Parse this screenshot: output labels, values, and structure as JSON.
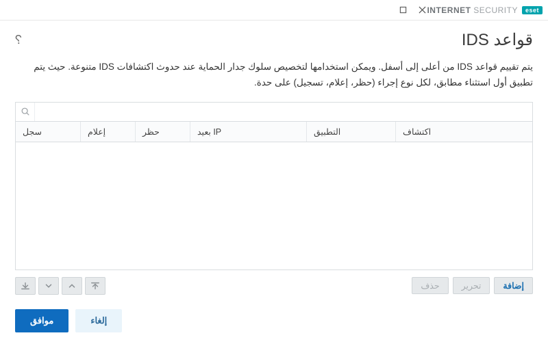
{
  "brand": {
    "logo": "eset",
    "strong": "INTERNET",
    "light": "SECURITY"
  },
  "page": {
    "title": "قواعد IDS",
    "description": "يتم تقييم قواعد IDS من أعلى إلى أسفل. ويمكن استخدامها لتخصيص سلوك جدار الحماية عند حدوث اكتشافات IDS متنوعة. حيث يتم تطبيق أول استثناء مطابق، لكل نوع إجراء (حظر، إعلام، تسجيل) على حدة."
  },
  "search": {
    "placeholder": ""
  },
  "columns": {
    "detect": "اكتشاف",
    "app": "التطبيق",
    "remote_ip": "IP بعيد",
    "block": "حظر",
    "notify": "إعلام",
    "log": "سجل"
  },
  "rows": [],
  "actions": {
    "add": "إضافة",
    "edit": "تحرير",
    "delete": "حذف"
  },
  "footer": {
    "ok": "موافق",
    "cancel": "إلغاء"
  }
}
